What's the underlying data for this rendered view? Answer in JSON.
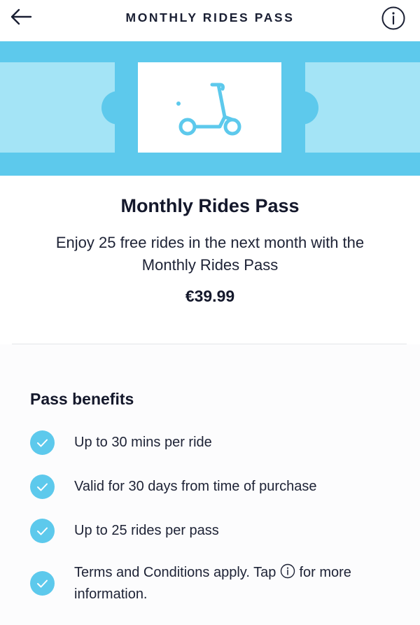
{
  "header": {
    "title": "MONTHLY RIDES PASS",
    "back_icon": "arrow-left-icon",
    "info_icon": "info-circle-icon"
  },
  "banner": {
    "illustration": "ticket-with-scooter-icon",
    "colors": {
      "band": "#5dc9ec",
      "ticket_side": "#a4e4f6",
      "ticket_center": "#ffffff",
      "scooter": "#5dc9ec"
    }
  },
  "pass": {
    "title": "Monthly Rides Pass",
    "description": "Enjoy 25 free rides in the next month with the Monthly Rides Pass",
    "price": "€39.99"
  },
  "benefits": {
    "heading": "Pass benefits",
    "check_icon": "check-circle-icon",
    "items": [
      {
        "text": "Up to 30 mins per ride"
      },
      {
        "text": "Valid for 30 days from time of purchase"
      },
      {
        "text": "Up to 25 rides per pass"
      },
      {
        "text_before_icon": "Terms and Conditions apply. Tap",
        "text_after_icon": "for more information.",
        "icon": "info-circle-icon"
      }
    ]
  },
  "colors": {
    "accent": "#5dc9ec",
    "text": "#14182b",
    "divider": "#e3e5e8"
  }
}
